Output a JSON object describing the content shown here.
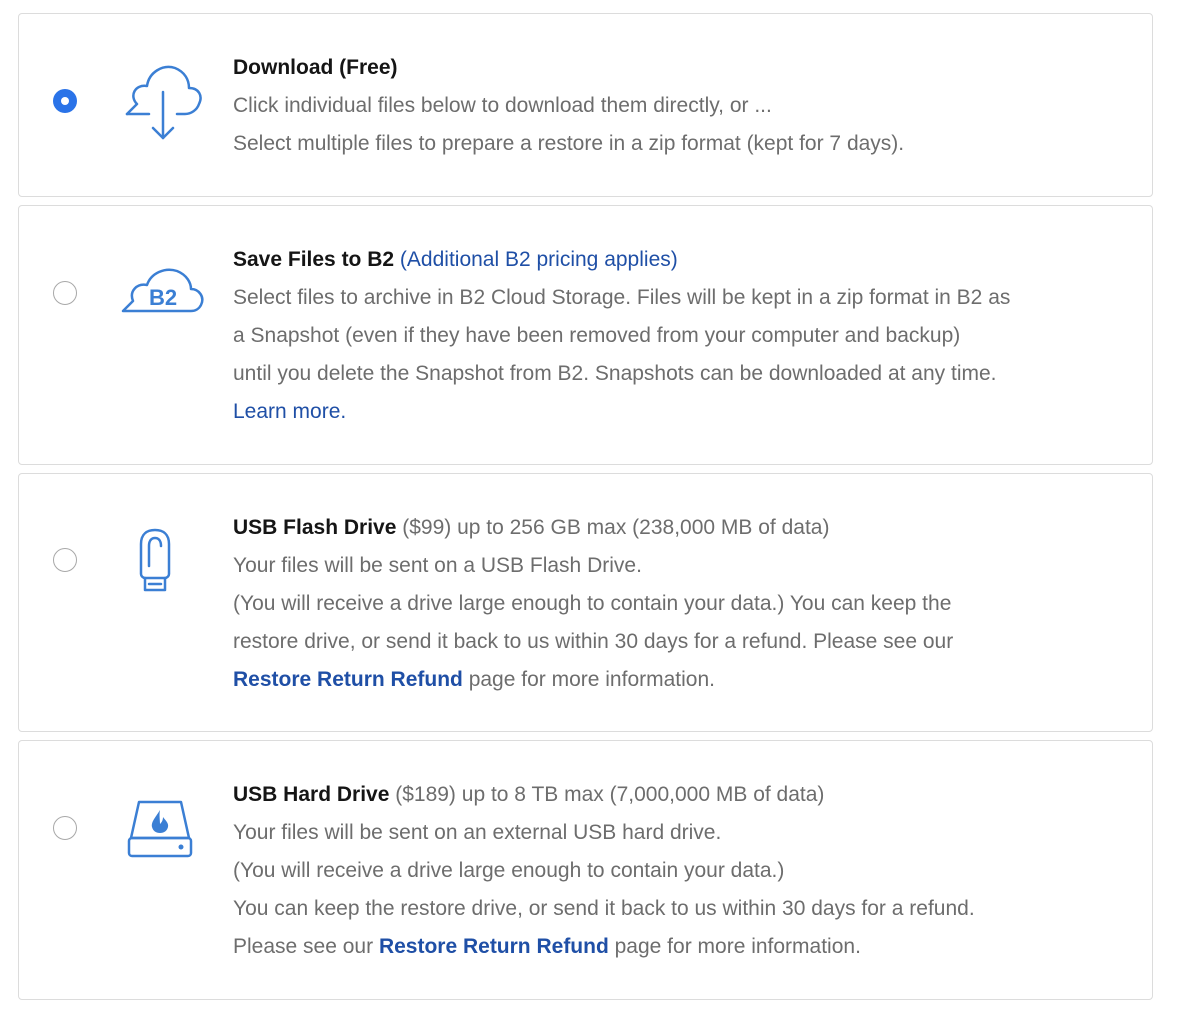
{
  "options": [
    {
      "title": "Download (Free)",
      "selected": true,
      "icon": "cloud-download-icon",
      "lines": [
        "Click individual files below to download them directly, or ...",
        "Select multiple files to prepare a restore in a zip format (kept for 7 days)."
      ]
    },
    {
      "title": "Save Files to B2",
      "title_link": "(Additional B2 pricing applies)",
      "selected": false,
      "icon": "b2-cloud-icon",
      "icon_text": "B2",
      "lines": [
        "Select files to archive in B2 Cloud Storage. Files will be kept in a zip format in B2 as",
        "a Snapshot (even if they have been removed from your computer and backup)",
        "until you delete the Snapshot from B2. Snapshots can be downloaded at any time."
      ],
      "learn_more": "Learn more."
    },
    {
      "title": "USB Flash Drive",
      "title_suffix": " ($99) up to 256 GB max (238,000 MB of data)",
      "selected": false,
      "icon": "usb-flash-drive-icon",
      "lines": [
        "Your files will be sent on a USB Flash Drive.",
        "(You will receive a drive large enough to contain your data.) You can keep the",
        "restore drive, or send it back to us within 30 days for a refund. Please see our"
      ],
      "refund_link": "Restore Return Refund",
      "refund_suffix": " page for more information."
    },
    {
      "title": "USB Hard Drive",
      "title_suffix": " ($189) up to 8 TB max (7,000,000 MB of data)",
      "selected": false,
      "icon": "usb-hard-drive-icon",
      "lines": [
        "Your files will be sent on an external USB hard drive.",
        "(You will receive a drive large enough to contain your data.)",
        "You can keep the restore drive, or send it back to us within 30 days for a refund."
      ],
      "refund_prefix": "Please see our ",
      "refund_link": "Restore Return Refund",
      "refund_suffix": " page for more information."
    }
  ],
  "colors": {
    "accent": "#2a73e8",
    "icon": "#3b7fd4",
    "link": "#1f4fa6",
    "title": "#151515",
    "body_text": "#6d6d6d",
    "border": "#dcdcdc"
  }
}
